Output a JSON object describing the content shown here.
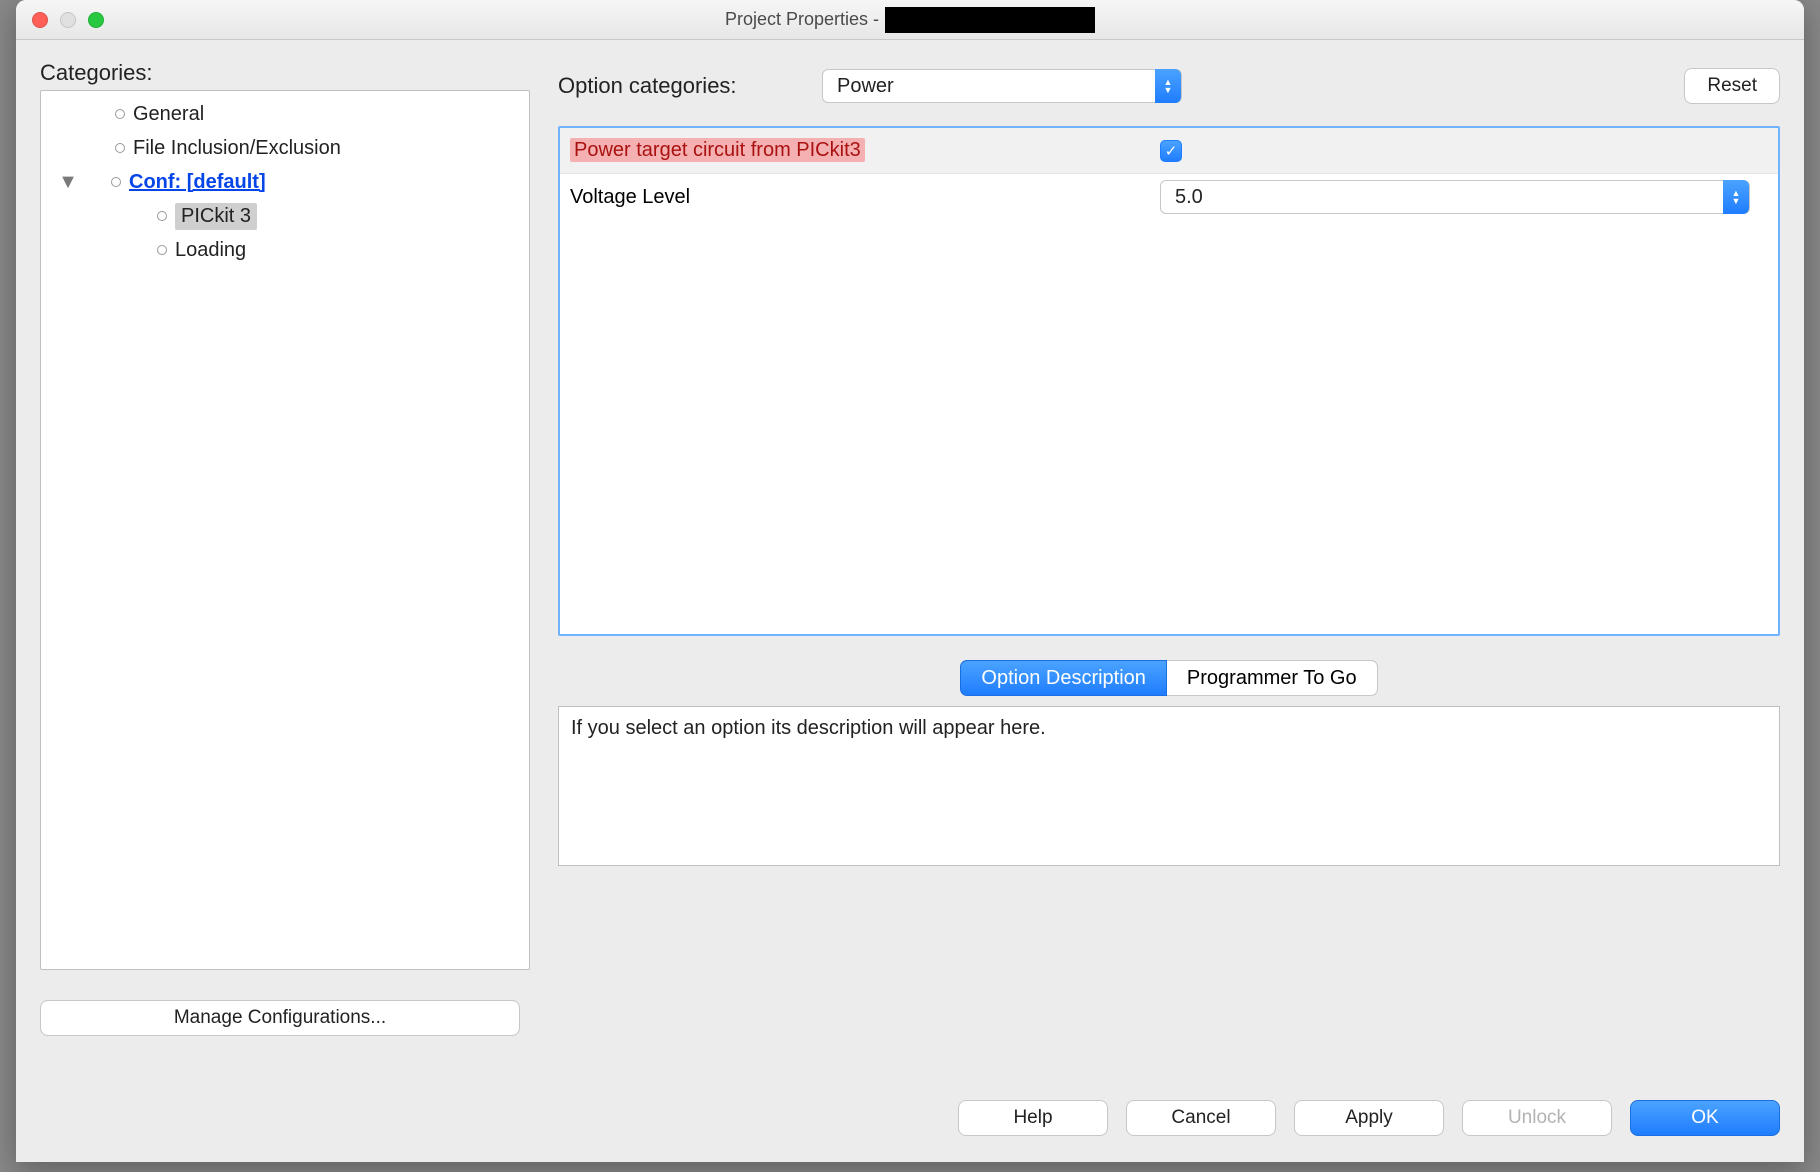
{
  "window": {
    "title": "Project Properties -"
  },
  "categories": {
    "label": "Categories:",
    "items": {
      "general": "General",
      "file_incl": "File Inclusion/Exclusion",
      "conf": "Conf: [default]",
      "pickit": "PICkit 3",
      "loading": "Loading"
    }
  },
  "options": {
    "cat_label": "Option categories:",
    "cat_value": "Power",
    "reset": "Reset",
    "row1_label": "Power target circuit from PICkit3",
    "row1_checked": true,
    "row2_label": "Voltage Level",
    "row2_value": "5.0"
  },
  "tabs": {
    "desc": "Option Description",
    "ptg": "Programmer To Go"
  },
  "description": "If you select an option its description will appear here.",
  "buttons": {
    "manage": "Manage Configurations...",
    "help": "Help",
    "cancel": "Cancel",
    "apply": "Apply",
    "unlock": "Unlock",
    "ok": "OK"
  }
}
